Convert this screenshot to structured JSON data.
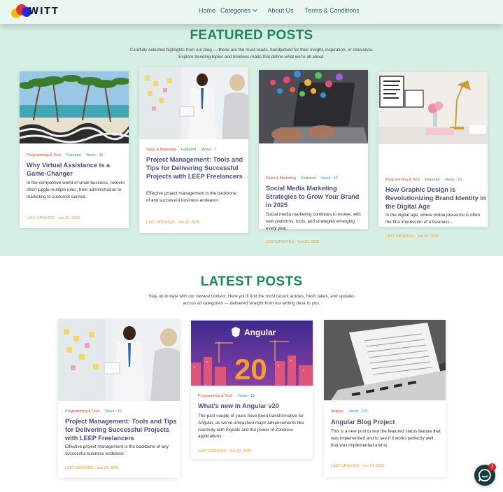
{
  "nav": {
    "logo_text": "WITT",
    "items": [
      "Home",
      "Categories",
      "About Us",
      "Terms & Conditions"
    ]
  },
  "featured": {
    "title": "FEATURED POSTS",
    "subtitle_line1": "Carefully selected highlights from our blog — these are the must-reads, handpicked for their insight, inspiration, or relevance.",
    "subtitle_line2": "Explore trending topics and timeless reads that define what we're all about.",
    "cards": [
      {
        "category": "Programming & Tech",
        "badge": "Featured",
        "views": "Views - 39",
        "title": "Why Virtual Assistance is a Game-Changer",
        "excerpt": "In the competitive world of small business, owners often juggle multiple roles, from administration to marketing to customer service.",
        "date": "LAST UPDATED - Jun 23, 2025",
        "image": "beach-palm-trees"
      },
      {
        "category": "Sales & Marketing",
        "badge": "Featured",
        "views": "Views - 7",
        "title": "Project Management: Tools and Tips for Delivering Successful Projects with LEEP Freelancers",
        "excerpt": "Effective project management is the backbone of any successful business endeavor.",
        "date": "LAST UPDATED - Jun 23, 2025",
        "image": "office-meeting"
      },
      {
        "category": "Sales & Marketing",
        "badge": "Featured",
        "views": "Views - 16",
        "title": "Social Media Marketing Strategies to Grow Your Brand in 2025",
        "excerpt": "Social media marketing continues to evolve, with new platforms, tools, and strategies emerging every year.",
        "date": "LAST UPDATED - Jun 23, 2025",
        "image": "laptop-social-icons"
      },
      {
        "category": "Programming & Tech",
        "badge": "Featured",
        "views": "Views - 15",
        "title": "How Graphic Design is Revolutionizing Brand Identity in the Digital Age",
        "excerpt": "In the digital age, where online presence is often the first impression of a business...",
        "date": "LAST UPDATED - Jun 20, 2025",
        "image": "desk-lamp"
      }
    ]
  },
  "latest": {
    "title": "LATEST POSTS",
    "subtitle_line1": "Stay up to date with our newest content. Here you'll find the most recent articles, fresh takes, and updates",
    "subtitle_line2": "across all categories — delivered straight from our writing desk to you.",
    "cards": [
      {
        "category": "Programming & Tech",
        "views": "Views - 15",
        "title": "Project Management: Tools and Tips for Delivering Successful Projects with LEEP Freelancers",
        "excerpt": "Effective project management is the backbone of any successful business endeavor.",
        "date": "LAST UPDATED - Jun 23, 2025",
        "image": "office-meeting"
      },
      {
        "category": "Programming & Tech",
        "views": "Views - 11",
        "title": "What's new in Angular v20",
        "excerpt": "The past couple of years have been transformative for Angular, as we've unleashed major advancements like reactivity with Signals and the power of Zoneless applications.",
        "date": "LAST UPDATED - Jun 23, 2025",
        "image": "angular-v20",
        "image_text": "Angular",
        "image_number": "20"
      },
      {
        "category": "Angular",
        "views": "Views - 131",
        "title": "Angular Blog Project",
        "excerpt": "This is a new post to test the featured status feature that was implemented and to see if it works perfectly well, that was implemented and to.",
        "date": "LAST UPDATED - Jun 19, 2025",
        "image": "laptop-document"
      }
    ]
  },
  "chat": {
    "badge_count": "1",
    "icon": "chat-bubble-icon"
  },
  "colors": {
    "accent": "#1a8a5c",
    "featured_bg": "#d7f0e5",
    "category": "#e0443b",
    "badge": "#2e9b4f",
    "views": "#3a8fc7",
    "date": "#f09a2a",
    "title": "#4a4e8a"
  }
}
